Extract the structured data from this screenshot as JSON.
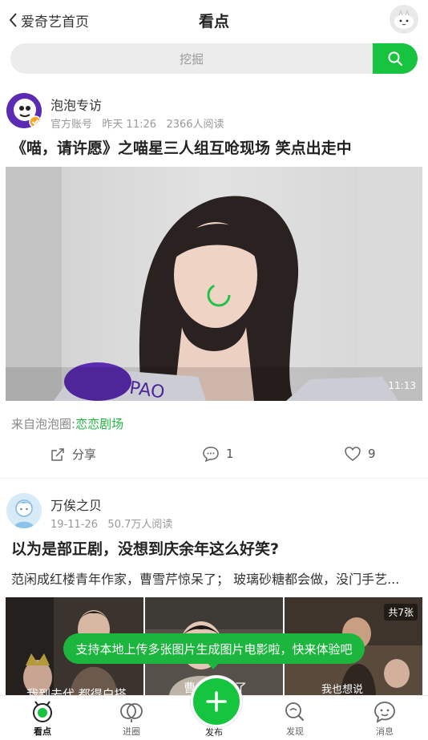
{
  "header": {
    "back_label": "爱奇艺首页",
    "title": "看点"
  },
  "search": {
    "placeholder": "挖掘"
  },
  "posts": [
    {
      "author": "泡泡专访",
      "account_type": "官方账号",
      "time": "昨天 11:26",
      "reads": "2366人阅读",
      "title": "《喵，请许愿》之喵星三人组互呛现场 笑点出走中",
      "video_duration": "11:13",
      "from_prefix": "来自泡泡圈:",
      "from_link": "恋恋剧场",
      "share_label": "分享",
      "comments": "1",
      "likes": "9"
    },
    {
      "author": "万俟之贝",
      "time": "19-11-26",
      "reads": "50.7万人阅读",
      "title": "以为是部正剧，没想到庆余年这么好笑?",
      "excerpt": "范闲成红楼青年作家，曹雪芹惊呆了；  玻璃砂糖都会做，没门手艺...",
      "image_count": "共7张",
      "thumb_captions": [
        "我到去代 都得白搭",
        "曹",
        "了",
        "我也想说"
      ]
    }
  ],
  "tooltip": "支持本地上传多张图片生成图片电影啦，快来体验吧",
  "tabs": [
    {
      "label": "看点",
      "icon": "kandian-icon",
      "active": true
    },
    {
      "label": "进圈",
      "icon": "circle-icon",
      "active": false
    },
    {
      "label": "发布",
      "icon": "plus-icon",
      "active": false
    },
    {
      "label": "发现",
      "icon": "discover-icon",
      "active": false
    },
    {
      "label": "消息",
      "icon": "message-icon",
      "active": false
    }
  ],
  "colors": {
    "accent": "#17c33f",
    "link": "#1cb63e"
  }
}
